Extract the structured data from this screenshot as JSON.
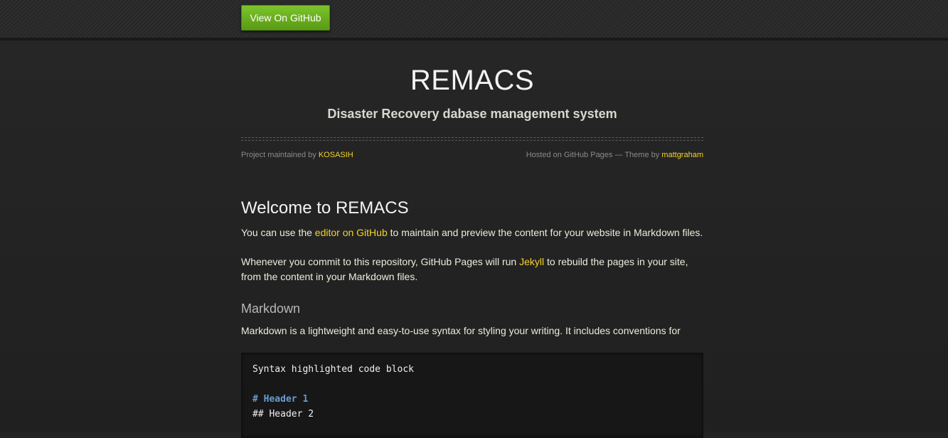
{
  "topbar": {
    "github_button": "View On GitHub"
  },
  "header": {
    "title": "REMACS",
    "subtitle": "Disaster Recovery dabase management system"
  },
  "credits": {
    "maintained_prefix": "Project maintained by ",
    "maintainer": "KOSASIH",
    "hosted_prefix": "Hosted on GitHub Pages — Theme by ",
    "theme_author": "mattgraham"
  },
  "content": {
    "welcome_heading": "Welcome to REMACS",
    "p1_before": "You can use the ",
    "p1_link": "editor on GitHub",
    "p1_after": " to maintain and preview the content for your website in Markdown files.",
    "p2_before": "Whenever you commit to this repository, GitHub Pages will run ",
    "p2_link": "Jekyll",
    "p2_after": " to rebuild the pages in your site, from the content in your Markdown files.",
    "markdown_heading": "Markdown",
    "p3": "Markdown is a lightweight and easy-to-use syntax for styling your writing. It includes conventions for",
    "code_lines": {
      "line1": "Syntax highlighted code block",
      "line2": "# Header 1",
      "line3": "## Header 2"
    }
  },
  "colors": {
    "link": "#f5d328",
    "button_green": "#6bb01f",
    "background": "#232323"
  }
}
